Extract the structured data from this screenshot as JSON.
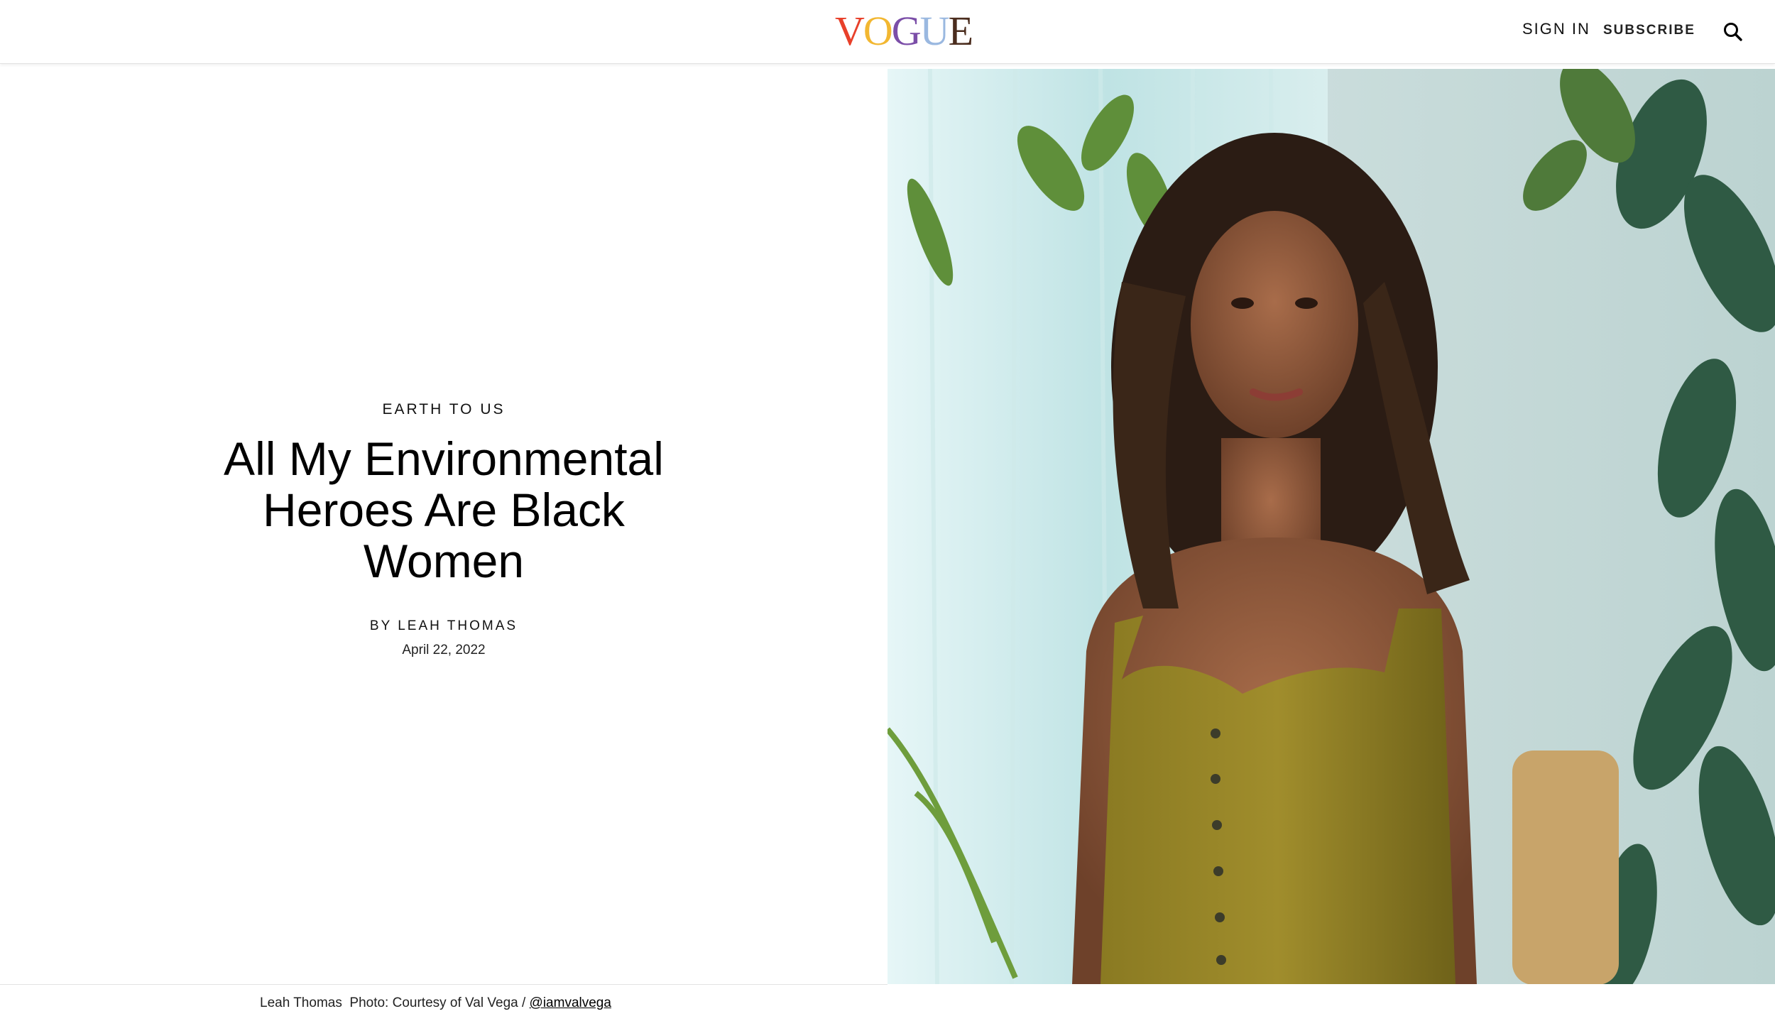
{
  "header": {
    "logo_letters": [
      "V",
      "O",
      "G",
      "U",
      "E"
    ],
    "logo_colors": [
      "#e8402a",
      "#f2b731",
      "#7b4ea8",
      "#9ab8e0",
      "#4b2d1e"
    ],
    "signin_label": "SIGN IN",
    "subscribe_label": "SUBSCRIBE",
    "search_icon": "search-icon"
  },
  "article": {
    "rubric": "EARTH TO US",
    "headline": "All My Environmental Heroes Are Black Women",
    "byline_prefix": "BY",
    "author": "LEAH THOMAS",
    "date": "April 22, 2022"
  },
  "photo": {
    "caption_subject": "Leah Thomas",
    "caption_credit": "Photo: Courtesy of Val Vega /",
    "caption_handle": "@iamvalvega"
  }
}
